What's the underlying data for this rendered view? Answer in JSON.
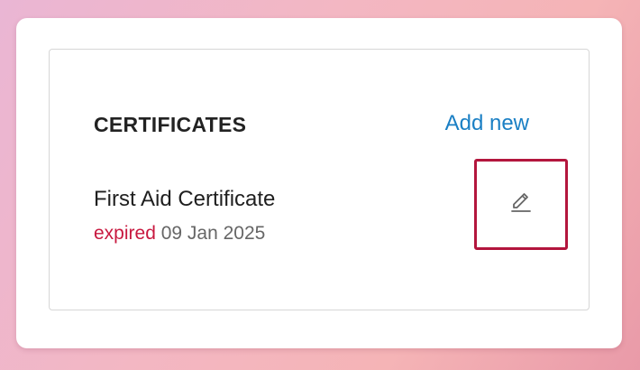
{
  "certificates": {
    "section_title": "CERTIFICATES",
    "add_new_label": "Add new",
    "items": [
      {
        "name": "First Aid Certificate",
        "status": "expired",
        "date": "09 Jan 2025",
        "edit_icon": "pencil-icon"
      }
    ]
  },
  "colors": {
    "accent_link": "#1a7fc4",
    "expired_status": "#c8183f",
    "highlight_border": "#b3163d"
  }
}
